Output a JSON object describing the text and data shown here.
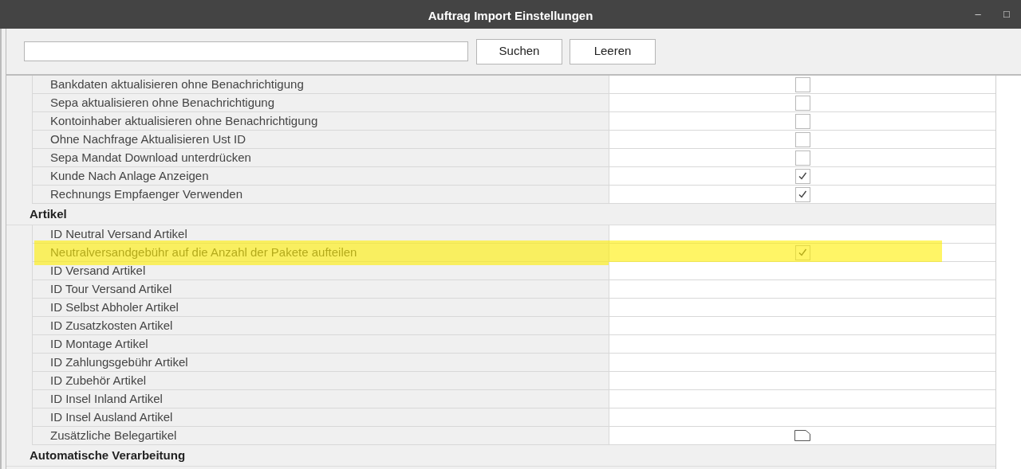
{
  "window": {
    "title": "Auftrag Import Einstellungen",
    "controls": [
      "–",
      "□"
    ]
  },
  "buttons": [
    "Suchen",
    "Leeren"
  ],
  "sections": [
    {
      "rows": [
        {
          "label": "Bankdaten aktualisieren ohne Benachrichtigung",
          "kind": "checkbox",
          "checked": false,
          "highlighted": false
        },
        {
          "label": "Sepa aktualisieren ohne Benachrichtigung",
          "kind": "checkbox",
          "checked": false,
          "highlighted": false
        },
        {
          "label": "Kontoinhaber aktualisieren ohne Benachrichtigung",
          "kind": "checkbox",
          "checked": false,
          "highlighted": false
        },
        {
          "label": "Ohne Nachfrage Aktualisieren Ust ID",
          "kind": "checkbox",
          "checked": false,
          "highlighted": false
        },
        {
          "label": "Sepa Mandat Download unterdrücken",
          "kind": "checkbox",
          "checked": false,
          "highlighted": false
        },
        {
          "label": "Kunde Nach Anlage Anzeigen",
          "kind": "checkbox",
          "checked": true,
          "highlighted": false
        },
        {
          "label": "Rechnungs Empfaenger Verwenden",
          "kind": "checkbox",
          "checked": true,
          "highlighted": false
        }
      ]
    },
    {
      "title": "Artikel",
      "rows": [
        {
          "label": "ID Neutral Versand Artikel",
          "kind": "text",
          "highlighted": false
        },
        {
          "label": "Neutralversandgebühr auf die Anzahl der Pakete aufteilen",
          "kind": "checkbox",
          "checked": true,
          "highlighted": true
        },
        {
          "label": "ID Versand Artikel",
          "kind": "text",
          "highlighted": false
        },
        {
          "label": "ID Tour Versand Artikel",
          "kind": "text",
          "highlighted": false
        },
        {
          "label": "ID Selbst Abholer Artikel",
          "kind": "text",
          "highlighted": false
        },
        {
          "label": "ID Zusatzkosten Artikel",
          "kind": "text",
          "highlighted": false
        },
        {
          "label": "ID Montage Artikel",
          "kind": "text",
          "highlighted": false
        },
        {
          "label": "ID Zahlungsgebühr Artikel",
          "kind": "text",
          "highlighted": false
        },
        {
          "label": "ID Zubehör Artikel",
          "kind": "text",
          "highlighted": false
        },
        {
          "label": "ID Insel Inland Artikel",
          "kind": "text",
          "highlighted": false
        },
        {
          "label": "ID Insel Ausland Artikel",
          "kind": "text",
          "highlighted": false
        },
        {
          "label": "Zusätzliche Belegartikel",
          "kind": "memo",
          "highlighted": false
        }
      ]
    },
    {
      "title": "Automatische Verarbeitung"
    }
  ]
}
